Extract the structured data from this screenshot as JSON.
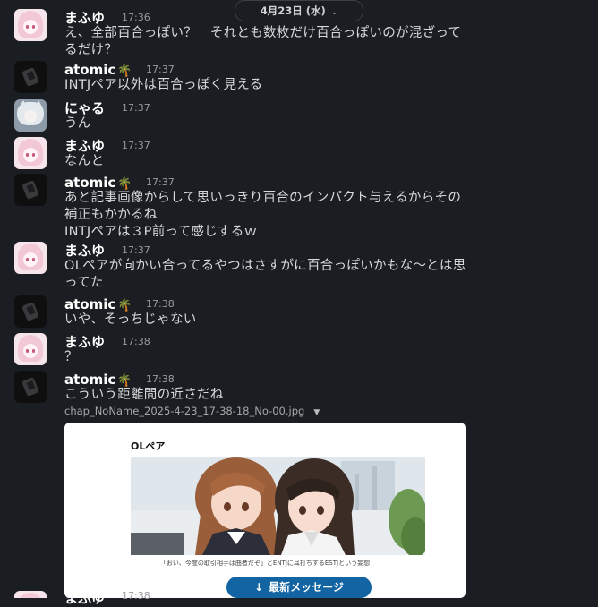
{
  "date_divider": {
    "label": "4月23日 (水)",
    "chevron": "chevron-down-icon"
  },
  "messages": [
    {
      "author": "まふゆ",
      "time": "17:36",
      "lines": [
        "え、全部百合っぽい？　それとも数枚だけ百合っぽいのが混ざって",
        "るだけ？"
      ]
    },
    {
      "author": "atomic",
      "emoji": "🌴",
      "time": "17:37",
      "lines": [
        "INTJペア以外は百合っぽく見える"
      ]
    },
    {
      "author": "にゃる",
      "time": "17:37",
      "lines": [
        "うん"
      ]
    },
    {
      "author": "まふゆ",
      "time": "17:37",
      "lines": [
        "なんと"
      ]
    },
    {
      "author": "atomic",
      "emoji": "🌴",
      "time": "17:37",
      "lines": [
        "あと記事画像からして思いっきり百合のインパクト与えるからその",
        "補正もかかるね",
        "INTJペアは３P前って感じするｗ"
      ]
    },
    {
      "author": "まふゆ",
      "time": "17:37",
      "lines": [
        "OLペアが向かい合ってるやつはさすがに百合っぽいかもな～とは思",
        "ってた"
      ]
    },
    {
      "author": "atomic",
      "emoji": "🌴",
      "time": "17:38",
      "lines": [
        "いや、そっちじゃない"
      ]
    },
    {
      "author": "まふゆ",
      "time": "17:38",
      "lines": [
        "？"
      ]
    },
    {
      "author": "atomic",
      "emoji": "🌴",
      "time": "17:38",
      "lines": [
        "こういう距離間の近さだね"
      ]
    }
  ],
  "attachment": {
    "filename": "chap_NoName_2025-4-23_17-38-18_No-00.jpg",
    "title": "OLペア",
    "caption": "「おい、今度の取引相手は曲者だぞ」とENTJに耳打ちするESTJという妄想"
  },
  "new_messages_button": {
    "label": "最新メッセージ",
    "icon": "arrow-down-icon"
  },
  "partial_next": {
    "author": "まふゆ",
    "time": "17:38"
  },
  "colors": {
    "background": "#1a1d21",
    "accent": "#1264a3",
    "text": "#d1d2d3"
  }
}
